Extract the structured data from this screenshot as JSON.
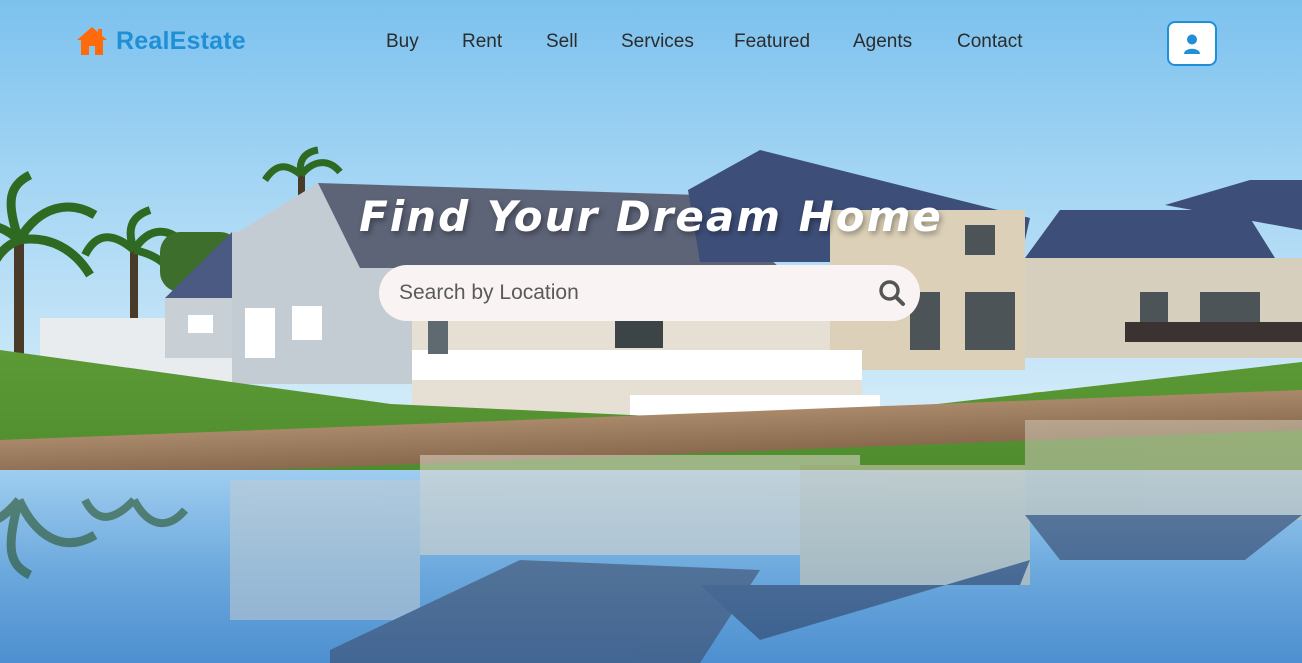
{
  "brand": {
    "name": "RealEstate",
    "icon": "house-icon",
    "color": "#1f8fd6",
    "icon_color": "#ff6b0a"
  },
  "nav": {
    "items": [
      {
        "label": "Buy"
      },
      {
        "label": "Rent"
      },
      {
        "label": "Sell"
      },
      {
        "label": "Services"
      },
      {
        "label": "Featured"
      },
      {
        "label": "Agents"
      },
      {
        "label": "Contact"
      }
    ],
    "account_icon": "user-icon"
  },
  "hero": {
    "title": "Find Your Dream Home",
    "search": {
      "placeholder": "Search by Location",
      "value": "",
      "icon": "search-icon"
    }
  }
}
